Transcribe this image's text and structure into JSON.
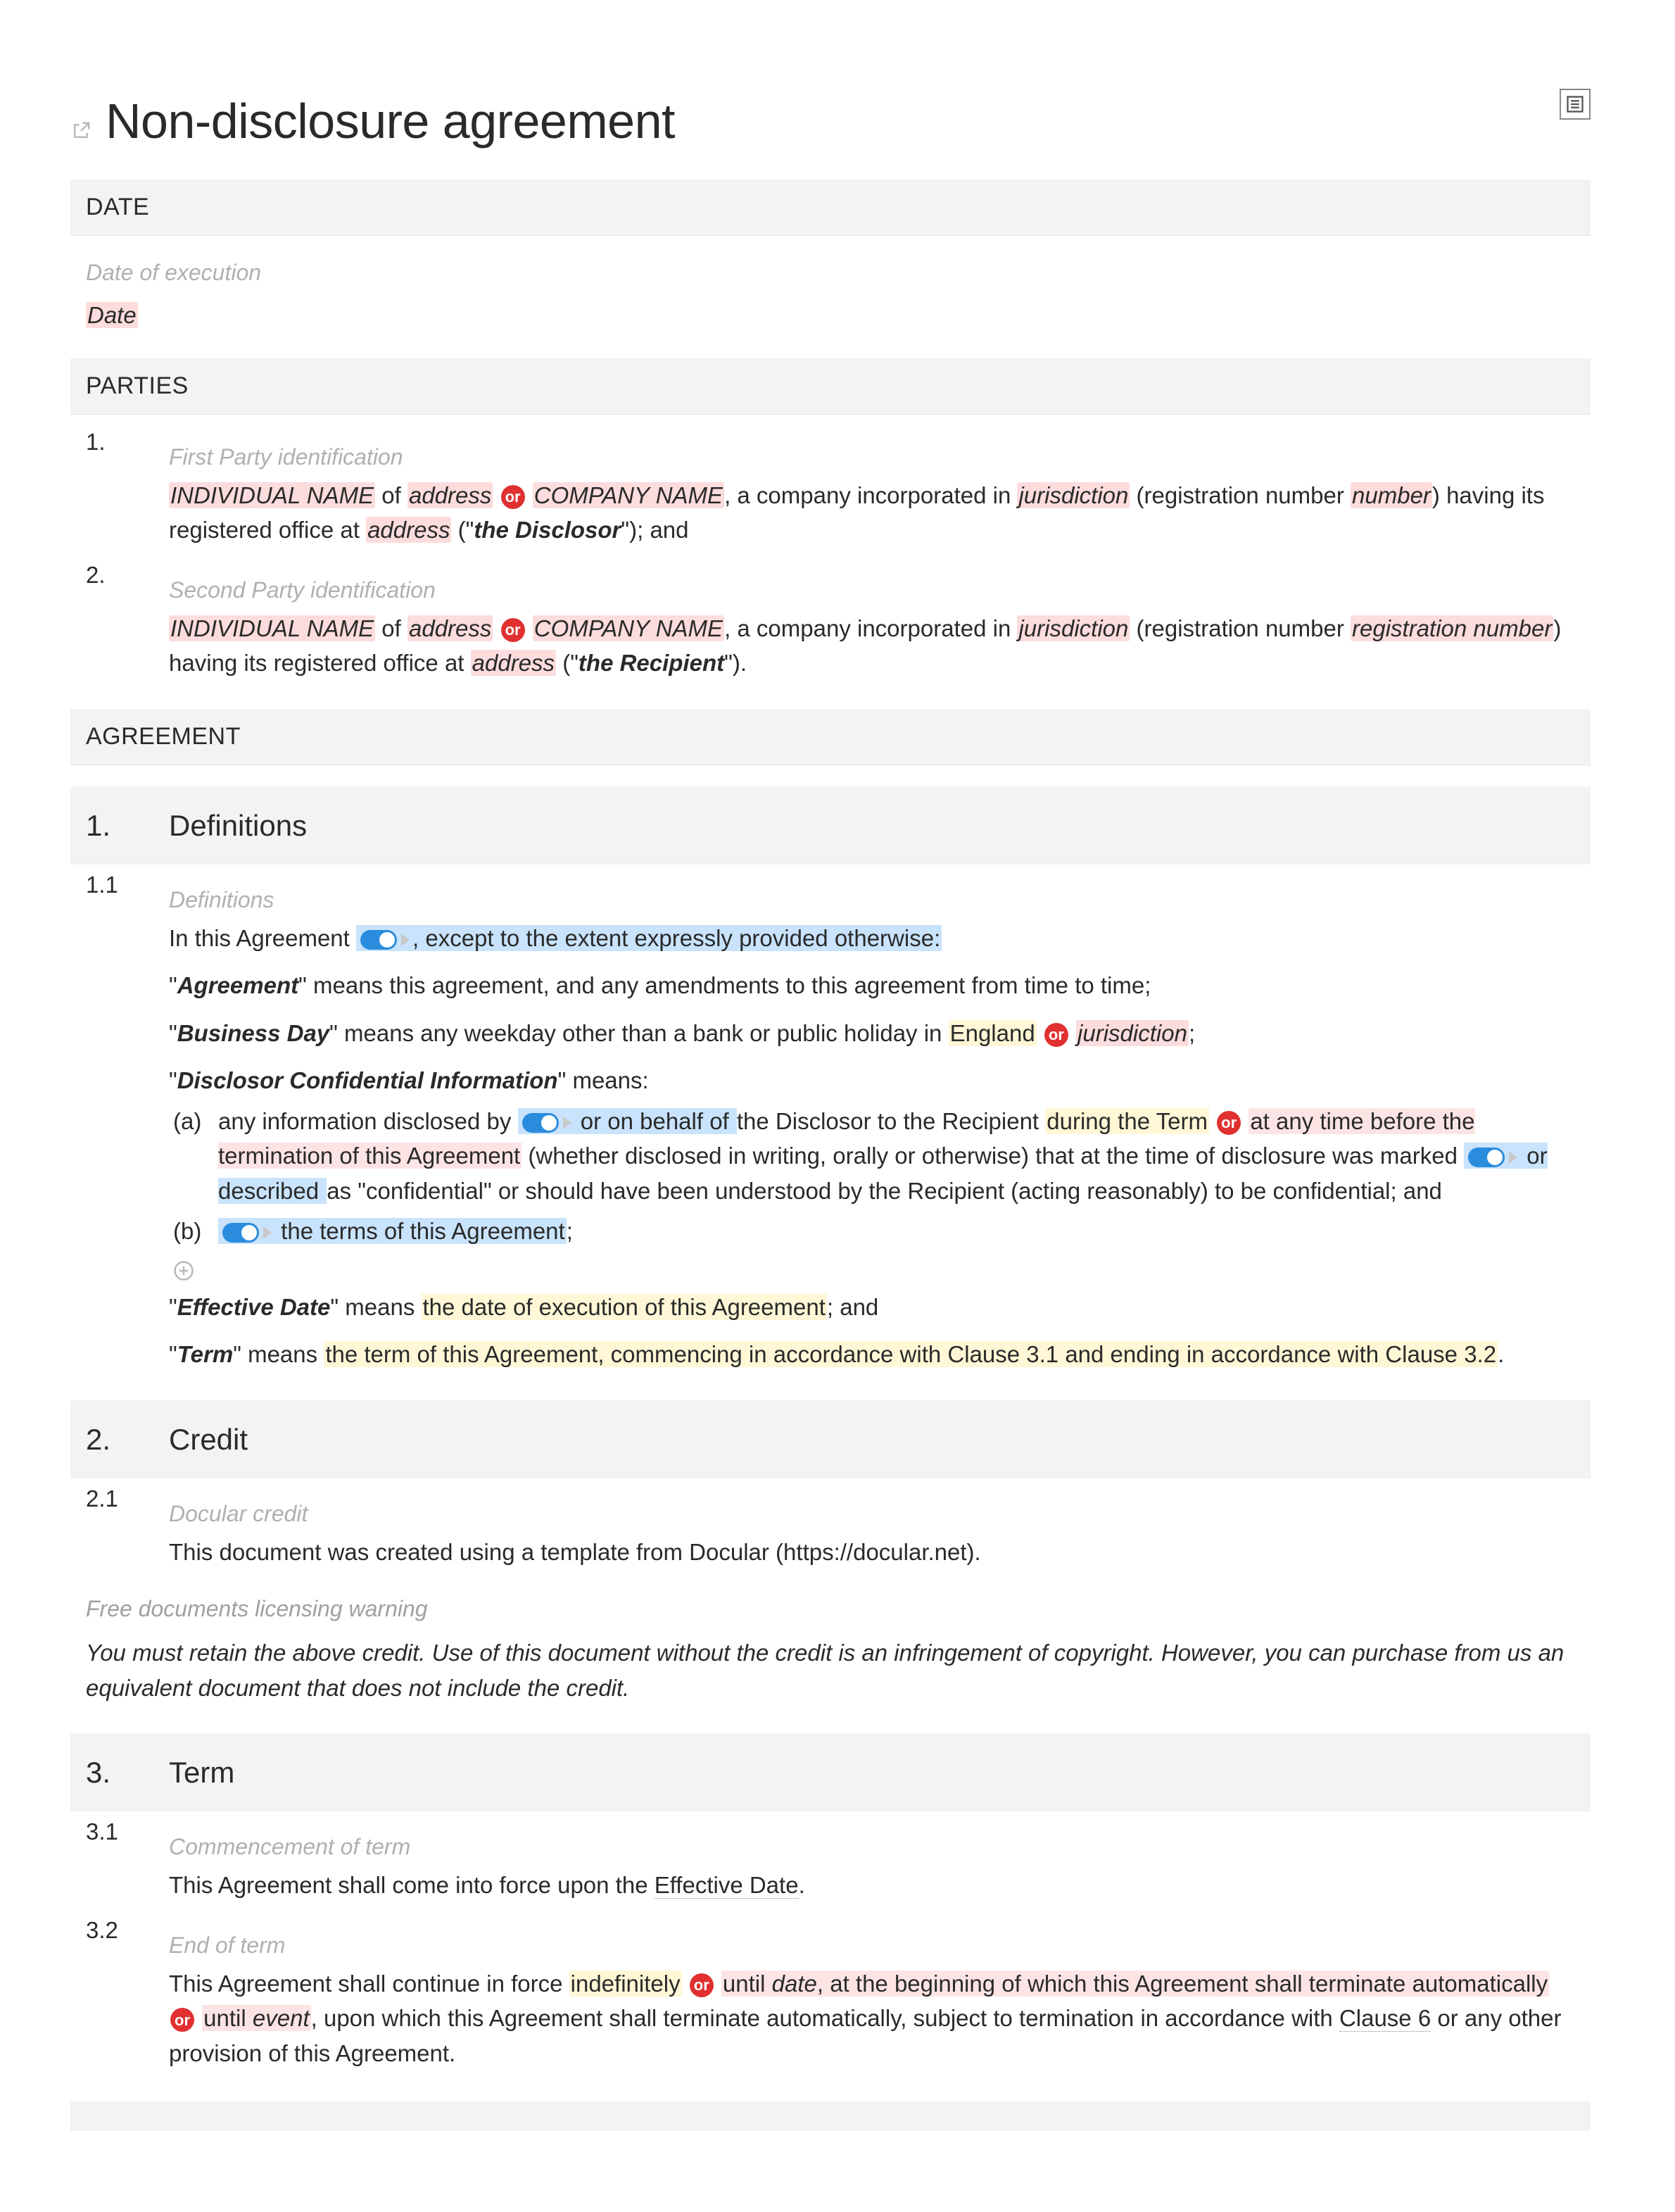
{
  "title": "Non-disclosure agreement",
  "sections": {
    "date_label": "DATE",
    "date_hint": "Date of execution",
    "date_value": "Date",
    "parties_label": "PARTIES",
    "party1_hint": "First Party identification",
    "party1_num": "1.",
    "party1_seg": {
      "name": "INDIVIDUAL NAME",
      "of": " of ",
      "addr": "address",
      "or": "or",
      "company": "COMPANY NAME",
      "incorp": ", a company incorporated in ",
      "juris": "jurisdiction",
      "reg_open": " (registration number ",
      "number": "number",
      "reg_close": ") having its registered office at ",
      "addr2": "address",
      "role_open": " (\"",
      "role": "the Disclosor",
      "role_close": "\"); and"
    },
    "party2_hint": "Second Party identification",
    "party2_num": "2.",
    "party2_seg": {
      "name": "INDIVIDUAL NAME",
      "of": " of ",
      "addr": "address",
      "or": "or",
      "company": "COMPANY NAME",
      "incorp": ", a company incorporated in ",
      "juris": "jurisdiction",
      "reg_open": " (registration number ",
      "number": "registration number",
      "reg_close": ") having its registered office at ",
      "addr2": "address",
      "role_open": " (\"",
      "role": "the Recipient",
      "role_close": "\")."
    },
    "agreement_label": "AGREEMENT"
  },
  "s1": {
    "num": "1.",
    "title": "Definitions",
    "hint": "Definitions",
    "c11_num": "1.1",
    "c11_pre": "In this Agreement",
    "c11_extent": ", except to the extent expressly provided otherwise:",
    "def_agreement_term": "Agreement",
    "def_agreement_body": "\" means this agreement, and any amendments to this agreement from time to time;",
    "def_bday_term": "Business Day",
    "def_bday_pre": "\" means any weekday other than a bank or public holiday in ",
    "def_bday_eng": "England",
    "def_bday_or": "or",
    "def_bday_juris": "jurisdiction",
    "def_bday_end": ";",
    "def_dci_term": "Disclosor Confidential Information",
    "def_dci_means": "\" means:",
    "a_label": "(a)",
    "a_pre": "any information disclosed by ",
    "a_onbehalf": " or on behalf of ",
    "a_mid1": "the Disclosor to the Recipient ",
    "a_during": "during the Term",
    "a_or": "or",
    "a_before": " at any time before the termination of this Agreement",
    "a_mid2": " (whether disclosed in writing, orally or otherwise) that at the time of disclosure was marked ",
    "a_ordesc": " or described ",
    "a_tail": "as \"confidential\" or should have been understood by the Recipient (acting reasonably) to be confidential; and",
    "b_label": "(b)",
    "b_terms": " the terms of this Agreement",
    "b_end": ";",
    "def_eff_term": "Effective Date",
    "def_eff_body_pre": "\" means ",
    "def_eff_body_hl": "the date of execution of this Agreement",
    "def_eff_body_end": "; and",
    "def_term_term": "Term",
    "def_term_pre": "\" means ",
    "def_term_hl1": "the term of this Agreement, commencing in accordance with Clause 3.1 and ending in accordance with Clause 3.2",
    "def_term_end": "."
  },
  "s2": {
    "num": "2.",
    "title": "Credit",
    "hint": "Docular credit",
    "c21_num": "2.1",
    "c21_body": "This document was created using a template from Docular (https://docular.net).",
    "warn_label": "Free documents licensing warning",
    "warn_body": "You must retain the above credit. Use of this document without the credit is an infringement of copyright. However, you can purchase from us an equivalent document that does not include the credit."
  },
  "s3": {
    "num": "3.",
    "title": "Term",
    "hint1": "Commencement of term",
    "c31_num": "3.1",
    "c31_pre": "This Agreement shall come into force upon the ",
    "c31_eff": "Effective Date",
    "c31_end": ".",
    "hint2": "End of term",
    "c32_num": "3.2",
    "c32_pre": "This Agreement shall continue in force ",
    "c32_indef": "indefinitely",
    "c32_or": "or",
    "c32_until1_pre": " until ",
    "c32_until1_date": "date",
    "c32_until1_tail": ", at the beginning of which this Agreement shall terminate automatically",
    "c32_or2": "or",
    "c32_until2_pre": " until ",
    "c32_until2_event": "event",
    "c32_tail": ", upon which this Agreement shall terminate automatically, subject to termination in accordance with ",
    "c32_clause6": "Clause 6",
    "c32_end": " or any other provision of this Agreement."
  },
  "labels": {
    "or": "or"
  }
}
